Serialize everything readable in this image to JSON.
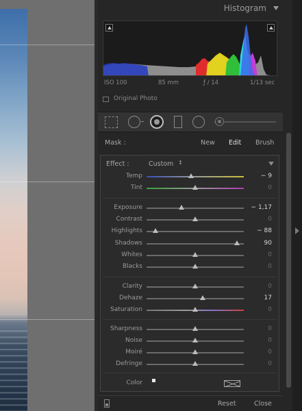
{
  "histogram": {
    "title": "Histogram",
    "exif": {
      "iso": "ISO 100",
      "focal": "85 mm",
      "aperture": "ƒ / 14",
      "shutter": "1/13 sec"
    },
    "original_photo_label": "Original Photo"
  },
  "mask": {
    "label": "Mask :",
    "options": {
      "new": "New",
      "edit": "Edit",
      "brush": "Brush"
    }
  },
  "effect": {
    "label": "Effect :",
    "value": "Custom",
    "updown": "↕"
  },
  "sliders": [
    {
      "id": "temp",
      "label": "Temp",
      "value": "− 9",
      "pos": 0.46,
      "active": true
    },
    {
      "id": "tint",
      "label": "Tint",
      "value": "0",
      "pos": 0.5,
      "active": false
    },
    {
      "id": "exposure",
      "label": "Exposure",
      "value": "− 1,17",
      "pos": 0.36,
      "active": true
    },
    {
      "id": "contrast",
      "label": "Contrast",
      "value": "0",
      "pos": 0.5,
      "active": false
    },
    {
      "id": "highlights",
      "label": "Highlights",
      "value": "− 88",
      "pos": 0.09,
      "active": true
    },
    {
      "id": "shadows",
      "label": "Shadows",
      "value": "90",
      "pos": 0.93,
      "active": true
    },
    {
      "id": "whites",
      "label": "Whites",
      "value": "0",
      "pos": 0.5,
      "active": false
    },
    {
      "id": "blacks",
      "label": "Blacks",
      "value": "0",
      "pos": 0.5,
      "active": false
    },
    {
      "id": "clarity",
      "label": "Clarity",
      "value": "0",
      "pos": 0.5,
      "active": false
    },
    {
      "id": "dehaze",
      "label": "Dehaze",
      "value": "17",
      "pos": 0.58,
      "active": true
    },
    {
      "id": "saturation",
      "label": "Saturation",
      "value": "0",
      "pos": 0.5,
      "active": false
    },
    {
      "id": "sharpness",
      "label": "Sharpness",
      "value": "0",
      "pos": 0.5,
      "active": false
    },
    {
      "id": "noise",
      "label": "Noise",
      "value": "0",
      "pos": 0.5,
      "active": false
    },
    {
      "id": "moire",
      "label": "Moiré",
      "value": "0",
      "pos": 0.5,
      "active": false
    },
    {
      "id": "defringe",
      "label": "Defringe",
      "value": "0",
      "pos": 0.5,
      "active": false
    }
  ],
  "color": {
    "label": "Color"
  },
  "footer": {
    "reset": "Reset",
    "close": "Close"
  },
  "colors": {
    "temp_track": "#3b4fb8-#c9c235",
    "tint_track": "#3d9e3d-#b03db0",
    "saturation_track": "#777-#d04040"
  }
}
